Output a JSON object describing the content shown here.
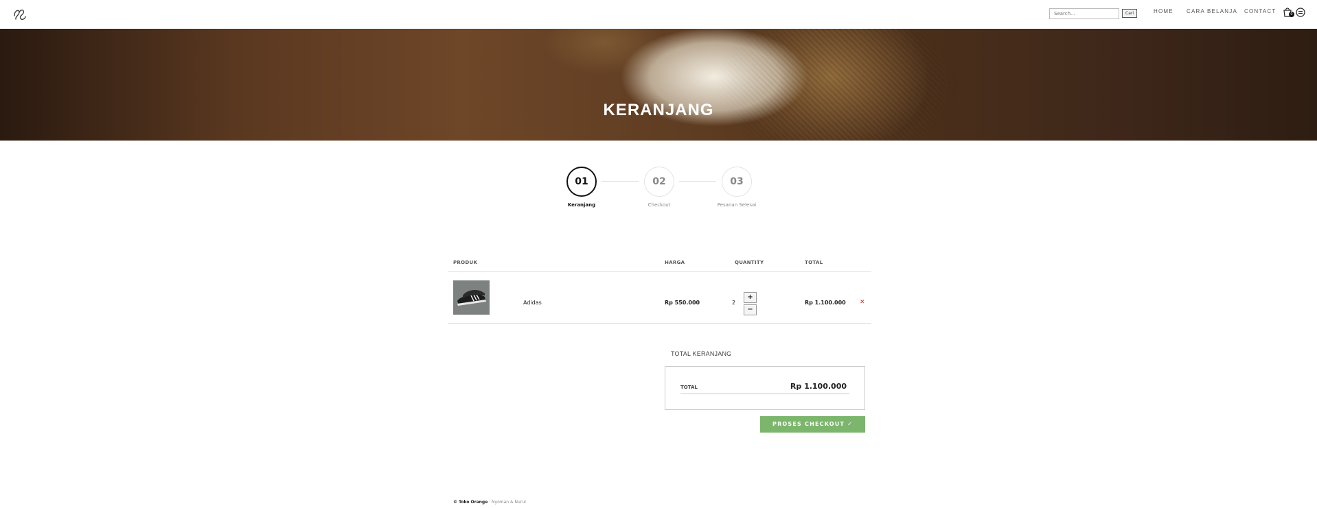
{
  "header": {
    "search_placeholder": "Search...",
    "search_button": "Cari",
    "nav": [
      "HOME",
      "CARA BELANJA",
      "CONTACT"
    ],
    "cart_count": "0"
  },
  "hero": {
    "title": "KERANJANG"
  },
  "steps": [
    {
      "number": "01",
      "label": "Keranjang",
      "active": true
    },
    {
      "number": "02",
      "label": "Checkout",
      "active": false
    },
    {
      "number": "03",
      "label": "Pesanan Selesai",
      "active": false
    }
  ],
  "table": {
    "headers": [
      "PRODUK",
      "HARGA",
      "QUANTITY",
      "TOTAL"
    ],
    "rows": [
      {
        "name": "Adidas",
        "price": "Rp 550.000",
        "quantity": "2",
        "total": "Rp 1.100.000",
        "plus": "+",
        "minus": "−",
        "remove": "✕"
      }
    ]
  },
  "totals": {
    "title": "TOTAL KERANJANG",
    "label": "TOTAL",
    "value": "Rp 1.100.000",
    "checkout_label": "PROSES CHECKOUT ✓"
  },
  "footer": {
    "brand": "© Toko Orange",
    "credit": "· Nyoman & Nurul"
  },
  "colors": {
    "checkout_green": "#7cb66d",
    "remove_red": "#e02020"
  }
}
